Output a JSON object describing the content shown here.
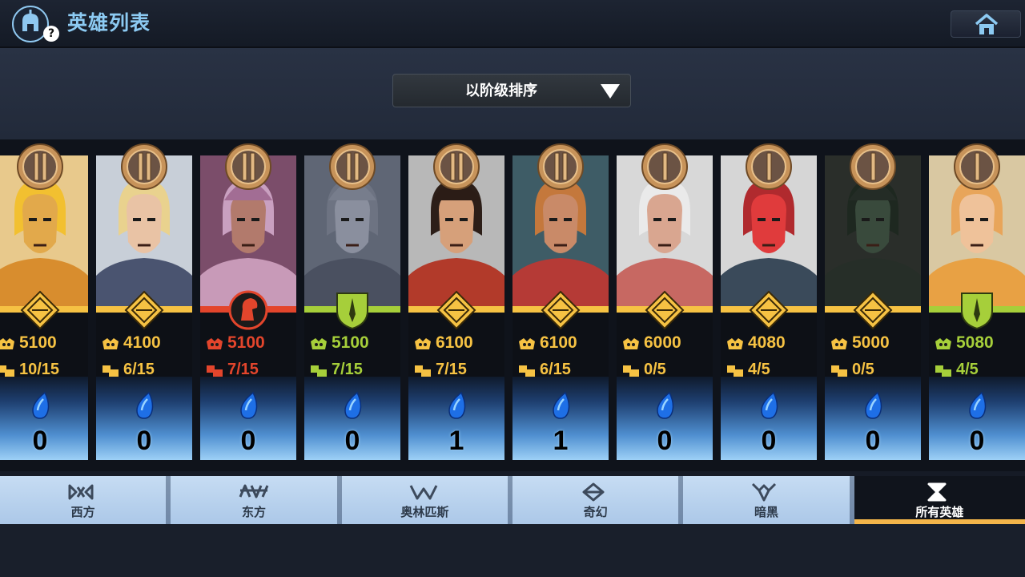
{
  "header": {
    "title": "英雄列表",
    "logo_icon": "spartan-helmet-icon",
    "help_glyph": "?",
    "home_icon": "home-icon"
  },
  "sort": {
    "label": "以阶级排序",
    "arrow_icon": "triangle-down-icon"
  },
  "colors": {
    "gold": "#f6c243",
    "red": "#e3452c",
    "green": "#a6cf3a",
    "tab_active_underline": "#f3b54a"
  },
  "heroes": [
    {
      "rank": "II",
      "class": "archer",
      "color": "gold",
      "power": "5100",
      "level": "10/15",
      "gems": "0",
      "portrait": "golden-winged-hero"
    },
    {
      "rank": "II",
      "class": "archer",
      "color": "gold",
      "power": "4100",
      "level": "6/15",
      "gems": "0",
      "portrait": "blonde-heroine"
    },
    {
      "rank": "II",
      "class": "cavalry",
      "color": "red",
      "power": "5100",
      "level": "7/15",
      "gems": "0",
      "portrait": "hooded-wizard"
    },
    {
      "rank": "II",
      "class": "infantry",
      "color": "green",
      "power": "5100",
      "level": "7/15",
      "gems": "0",
      "portrait": "armored-knight"
    },
    {
      "rank": "II",
      "class": "archer",
      "color": "gold",
      "power": "6100",
      "level": "7/15",
      "gems": "1",
      "portrait": "eastern-general"
    },
    {
      "rank": "II",
      "class": "archer",
      "color": "gold",
      "power": "6100",
      "level": "6/15",
      "gems": "1",
      "portrait": "huntress"
    },
    {
      "rank": "I",
      "class": "archer",
      "color": "gold",
      "power": "6000",
      "level": "0/5",
      "gems": "0",
      "portrait": "old-sage"
    },
    {
      "rank": "I",
      "class": "archer",
      "color": "gold",
      "power": "4080",
      "level": "4/5",
      "gems": "0",
      "portrait": "red-demon"
    },
    {
      "rank": "I",
      "class": "archer",
      "color": "gold",
      "power": "5000",
      "level": "0/5",
      "gems": "0",
      "portrait": "dark-reaper"
    },
    {
      "rank": "I",
      "class": "infantry",
      "color": "green",
      "power": "5080",
      "level": "4/5",
      "gems": "0",
      "portrait": "winged-valkyrie"
    }
  ],
  "tabs": [
    {
      "label": "西方",
      "icon": "western-faction-icon",
      "active": false
    },
    {
      "label": "东方",
      "icon": "eastern-faction-icon",
      "active": false
    },
    {
      "label": "奥林匹斯",
      "icon": "olympus-faction-icon",
      "active": false
    },
    {
      "label": "奇幻",
      "icon": "fantasy-faction-icon",
      "active": false
    },
    {
      "label": "暗黑",
      "icon": "dark-faction-icon",
      "active": false
    },
    {
      "label": "所有英雄",
      "icon": "hourglass-icon",
      "active": true
    }
  ]
}
